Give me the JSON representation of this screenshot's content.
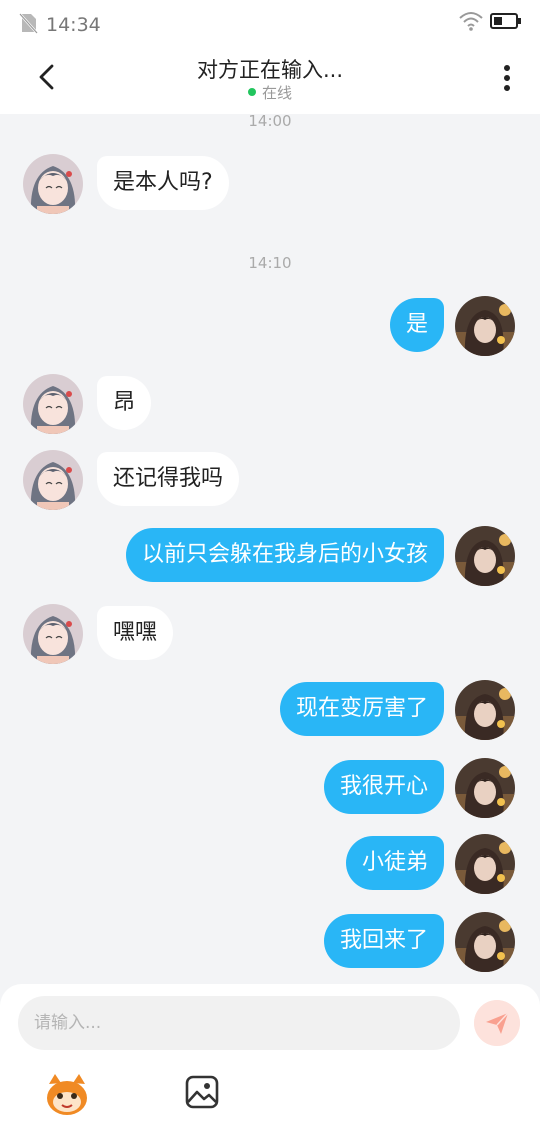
{
  "status_bar": {
    "time": "14:34"
  },
  "header": {
    "title": "对方正在输入...",
    "online_status": "在线"
  },
  "chat": {
    "timestamps": [
      "14:00",
      "14:10"
    ],
    "messages": [
      {
        "side": "in",
        "text": "是本人吗?"
      },
      {
        "side": "out",
        "text": "是"
      },
      {
        "side": "in",
        "text": "昂"
      },
      {
        "side": "in",
        "text": "还记得我吗"
      },
      {
        "side": "out",
        "text": "以前只会躲在我身后的小女孩"
      },
      {
        "side": "in",
        "text": "嘿嘿"
      },
      {
        "side": "out",
        "text": "现在变厉害了"
      },
      {
        "side": "out",
        "text": "我很开心"
      },
      {
        "side": "out",
        "text": "小徒弟"
      },
      {
        "side": "out",
        "text": "我回来了"
      }
    ]
  },
  "input": {
    "placeholder": "请输入..."
  },
  "icons": {
    "sim": "no-sim-icon",
    "wifi": "wifi-icon",
    "battery": "battery-icon",
    "back": "back-arrow-icon",
    "more": "more-vertical-icon",
    "send": "send-icon",
    "emoji": "emoji-sticker-icon",
    "image": "image-icon"
  },
  "colors": {
    "accent": "#29b6f6",
    "online_dot": "#22c55e",
    "chat_background": "#f3f4f6",
    "send_button": "#fde2dc",
    "send_arrow": "#f9a08f"
  }
}
